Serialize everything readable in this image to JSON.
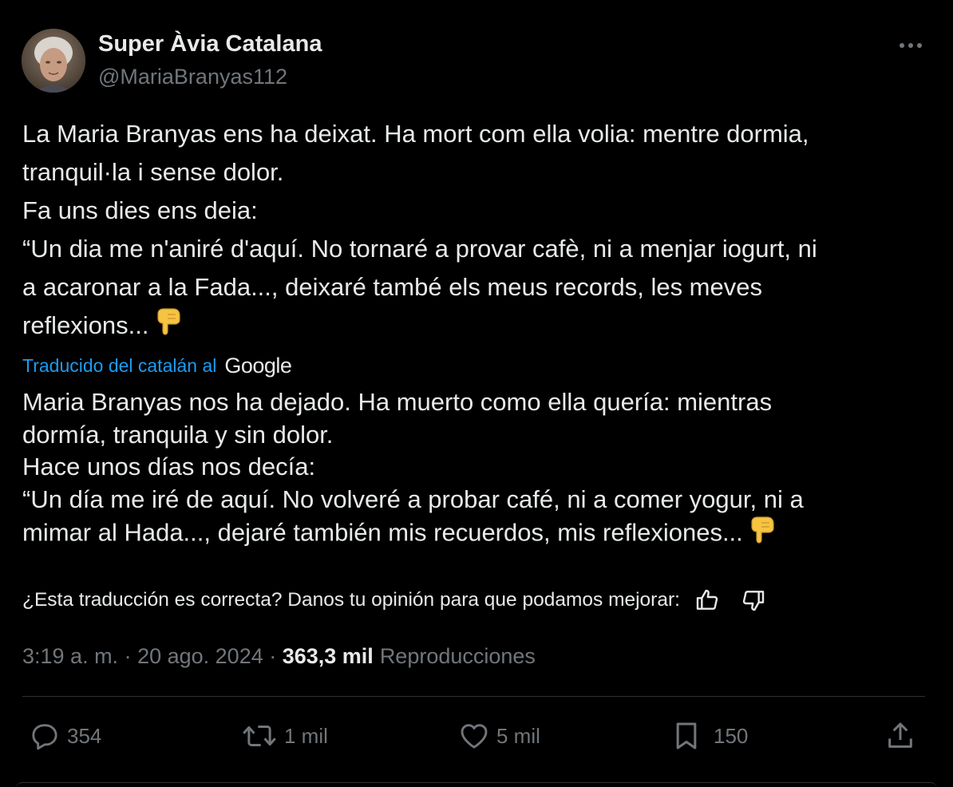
{
  "author": {
    "display_name": "Super Àvia Catalana",
    "handle": "@MariaBranyas112",
    "avatar_icon": "avatar-photo"
  },
  "header": {
    "more_icon": "more-icon"
  },
  "original_text": {
    "line1": "La Maria Branyas ens ha deixat. Ha mort com ella volia: mentre dormia,",
    "line2": "tranquil·la i sense dolor.",
    "line3": "Fa uns dies ens deia:",
    "line4": "“Un dia me n'aniré d'aquí. No tornaré a provar cafè, ni a menjar iogurt, ni",
    "line5": "a acaronar a la Fada..., deixaré també els meus records, les meves",
    "line6": "reflexions..."
  },
  "translation_notice": {
    "label": "Traducido del catalán al",
    "provider": "Google"
  },
  "translated_text": {
    "line1": "Maria Branyas nos ha dejado. Ha muerto como ella quería: mientras",
    "line2": "dormía, tranquila y sin dolor.",
    "line3": "Hace unos días nos decía:",
    "line4": "“Un día me iré de aquí. No volveré a probar café, ni a comer yogur, ni a",
    "line5": "mimar al Hada..., dejaré también mis recuerdos, mis reflexiones..."
  },
  "feedback": {
    "question": "¿Esta traducción es correcta? Danos tu opinión para que podamos mejorar:",
    "thumbs_up_icon": "thumbs-up-icon",
    "thumbs_down_icon": "thumbs-down-icon"
  },
  "meta": {
    "time": "3:19 a. m.",
    "separator1": " · ",
    "date": "20 ago. 2024",
    "separator2": " · ",
    "views_count": "363,3 mil",
    "views_label": "Reproducciones"
  },
  "actions": {
    "reply": {
      "icon": "reply-icon",
      "count": "354"
    },
    "retweet": {
      "icon": "retweet-icon",
      "count": "1 mil"
    },
    "like": {
      "icon": "heart-icon",
      "count": "5 mil"
    },
    "bookmark": {
      "icon": "bookmark-icon",
      "count": "150"
    },
    "share": {
      "icon": "share-icon"
    }
  },
  "colors": {
    "background": "#000000",
    "text": "#e7e9ea",
    "muted": "#71767b",
    "link": "#1d9bf0",
    "divider": "#2f3336",
    "emoji": "#f5c542"
  }
}
